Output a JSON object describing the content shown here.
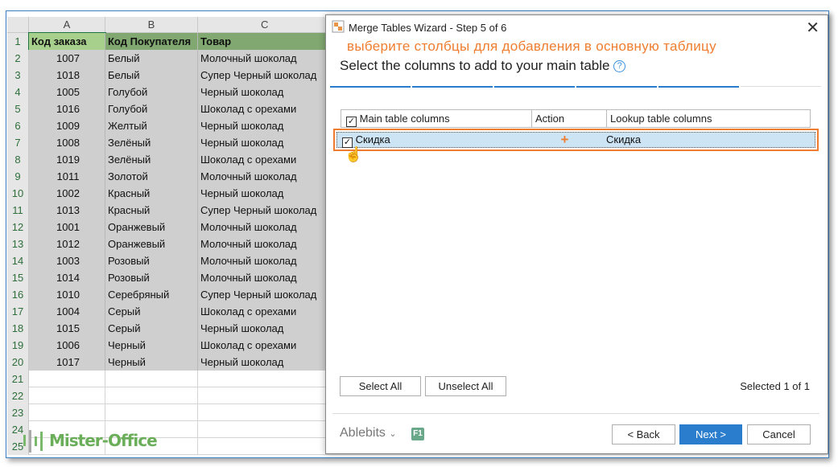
{
  "sheet": {
    "columns": [
      "A",
      "B",
      "C"
    ],
    "header": [
      "Код заказа",
      "Код Покупателя",
      "Товар"
    ],
    "rows": [
      [
        "1007",
        "Белый",
        "Молочный шоколад"
      ],
      [
        "1018",
        "Белый",
        "Супер Черный шоколад"
      ],
      [
        "1005",
        "Голубой",
        "Черный шоколад"
      ],
      [
        "1016",
        "Голубой",
        "Шоколад с орехами"
      ],
      [
        "1009",
        "Желтый",
        "Черный шоколад"
      ],
      [
        "1008",
        "Зелёный",
        "Черный шоколад"
      ],
      [
        "1019",
        "Зелёный",
        "Шоколад с орехами"
      ],
      [
        "1011",
        "Золотой",
        "Молочный шоколад"
      ],
      [
        "1002",
        "Красный",
        "Черный шоколад"
      ],
      [
        "1013",
        "Красный",
        "Супер Черный шоколад"
      ],
      [
        "1001",
        "Оранжевый",
        "Молочный шоколад"
      ],
      [
        "1012",
        "Оранжевый",
        "Молочный шоколад"
      ],
      [
        "1003",
        "Розовый",
        "Молочный шоколад"
      ],
      [
        "1014",
        "Розовый",
        "Молочный шоколад"
      ],
      [
        "1010",
        "Серебряный",
        "Супер Черный шоколад"
      ],
      [
        "1004",
        "Серый",
        "Шоколад с орехами"
      ],
      [
        "1015",
        "Серый",
        "Черный шоколад"
      ],
      [
        "1006",
        "Черный",
        "Шоколад с орехами"
      ],
      [
        "1017",
        "Черный",
        "Черный шоколад"
      ]
    ],
    "row_numbers": [
      "1",
      "2",
      "3",
      "4",
      "5",
      "6",
      "7",
      "8",
      "9",
      "10",
      "11",
      "12",
      "13",
      "14",
      "15",
      "16",
      "17",
      "18",
      "19",
      "20",
      "21",
      "22",
      "23",
      "24",
      "25"
    ]
  },
  "watermark": "Mister-Office",
  "wizard": {
    "title": "Merge Tables Wizard - Step 5 of 6",
    "annotation": "выберите столбцы для добавления в основную таблицу",
    "heading": "Select the columns to add to your main table",
    "columns": [
      "Main table columns",
      "Action",
      "Lookup table columns"
    ],
    "row": {
      "main": "Скидка",
      "action": "+",
      "lookup": "Скидка",
      "checked": true
    },
    "select_all": "Select All",
    "unselect_all": "Unselect All",
    "selected": "Selected 1 of 1",
    "brand": "Ablebits",
    "f1": "F1",
    "back": "< Back",
    "next": "Next >",
    "cancel": "Cancel",
    "steps_total": 6,
    "step_current": 5
  },
  "colors": {
    "accent": "#ef7d2f",
    "blue": "#2a7ccc",
    "excel_green": "#217346"
  }
}
